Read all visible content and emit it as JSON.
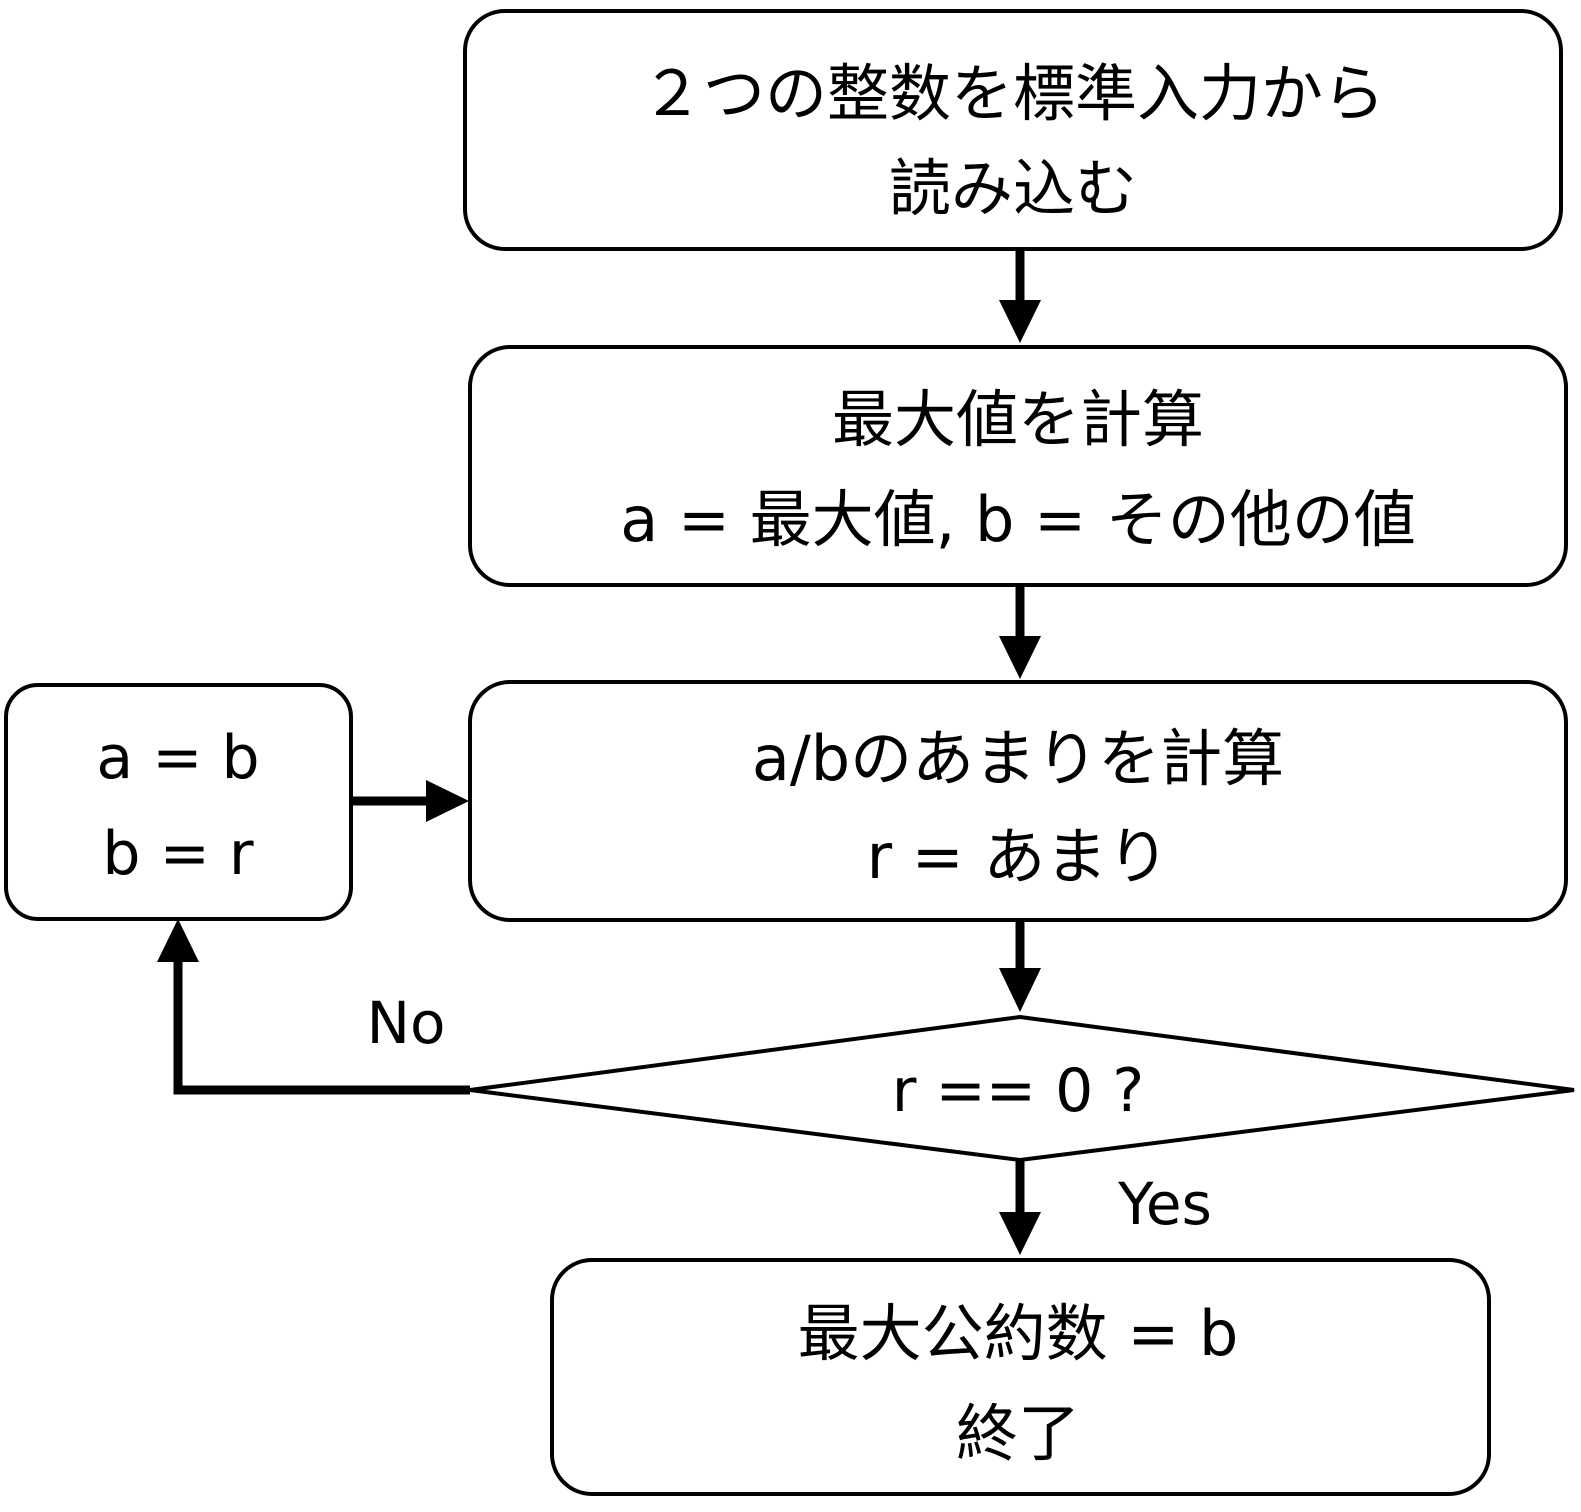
{
  "nodes": {
    "input": {
      "line1": "２つの整数を標準入力から",
      "line2": "読み込む"
    },
    "max": {
      "line1": "最大値を計算",
      "line2": "a = 最大値, b = その他の値"
    },
    "remainder": {
      "line1": "a/bのあまりを計算",
      "line2": "r = あまり"
    },
    "swap": {
      "line1": "a = b",
      "line2": "b = r"
    },
    "decision": {
      "label": "r == 0 ?"
    },
    "end": {
      "line1": "最大公約数 = b",
      "line2": "終了"
    }
  },
  "edges": {
    "no_label": "No",
    "yes_label": "Yes"
  }
}
